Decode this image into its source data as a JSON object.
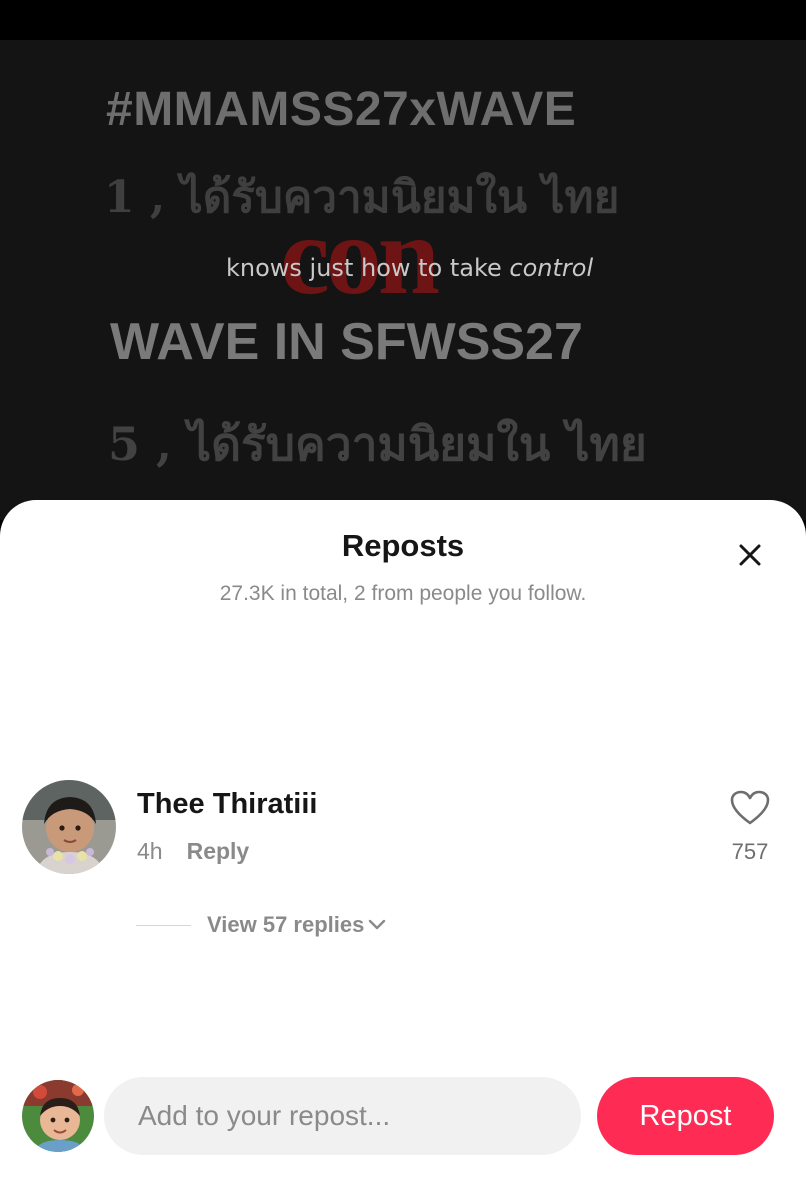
{
  "video": {
    "hashtag": "#MMAMSS27xWAVE",
    "line_thai_1": "1 , ได้รับความนิยมใน ไทย",
    "red_text": "con",
    "caption_main": "knows just how to take ",
    "caption_italic": "control",
    "line_wave": "WAVE IN SFWSS27",
    "line_thai_5": "5 , ได้รับความนิยมใน ไทย"
  },
  "sheet": {
    "title": "Reposts",
    "subtitle": "27.3K in total, 2 from people you follow.",
    "close_icon": "close-icon"
  },
  "repost": {
    "username": "Thee Thiratiii",
    "time": "4h",
    "reply_label": "Reply",
    "like_count": "757",
    "view_replies_label": "View 57 replies"
  },
  "composer": {
    "placeholder": "Add to your repost...",
    "button_label": "Repost"
  },
  "colors": {
    "accent": "#fe2c55",
    "sheet_bg": "#ffffff",
    "video_bg": "#141414",
    "muted_text": "#8a8a8a"
  }
}
